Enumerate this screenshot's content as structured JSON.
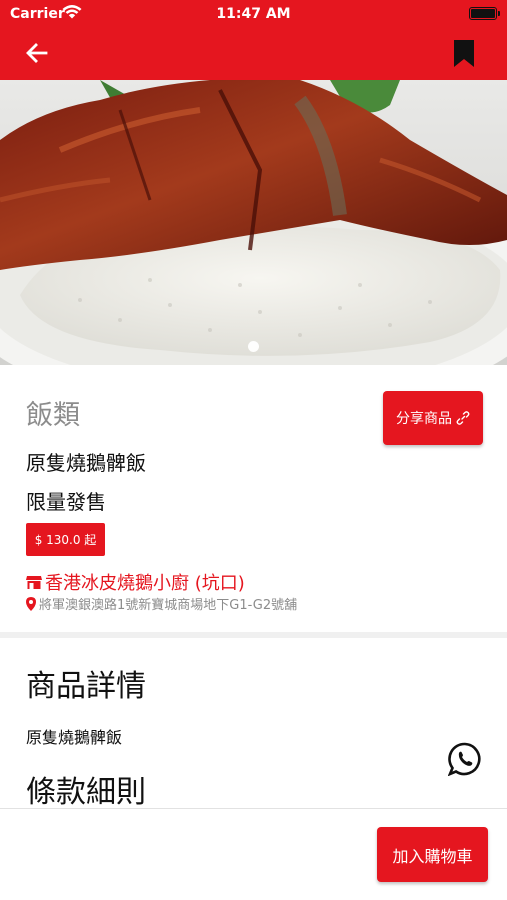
{
  "status_bar": {
    "carrier": "Carrier",
    "time": "11:47 AM",
    "icons": [
      "wifi-icon",
      "battery-icon"
    ]
  },
  "nav": {
    "back_icon": "arrow-left-icon",
    "bookmark_icon": "bookmark-icon",
    "color": "#e5161f"
  },
  "gallery": {
    "image": "roast-goose-leg-rice-photo",
    "page_count": 1,
    "current_page": 1
  },
  "product": {
    "category": "飯類",
    "share_label": "分享商品",
    "share_icon": "link-icon",
    "name": "原隻燒鵝髀飯",
    "tag": "限量發售",
    "price": "$ 130.0 起",
    "store_icon": "store-icon",
    "store_name": "香港冰皮燒鵝小廚 (坑口)",
    "address_icon": "location-pin-icon",
    "address": "將軍澳銀澳路1號新寶城商場地下G1-G2號舖"
  },
  "details": {
    "title": "商品詳情",
    "text": "原隻燒鵝髀飯",
    "terms_title": "條款細則",
    "whatsapp_icon": "whatsapp-icon"
  },
  "bottom": {
    "add_to_cart": "加入購物車"
  },
  "colors": {
    "accent": "#e5161f",
    "muted": "#8c8c8c"
  }
}
